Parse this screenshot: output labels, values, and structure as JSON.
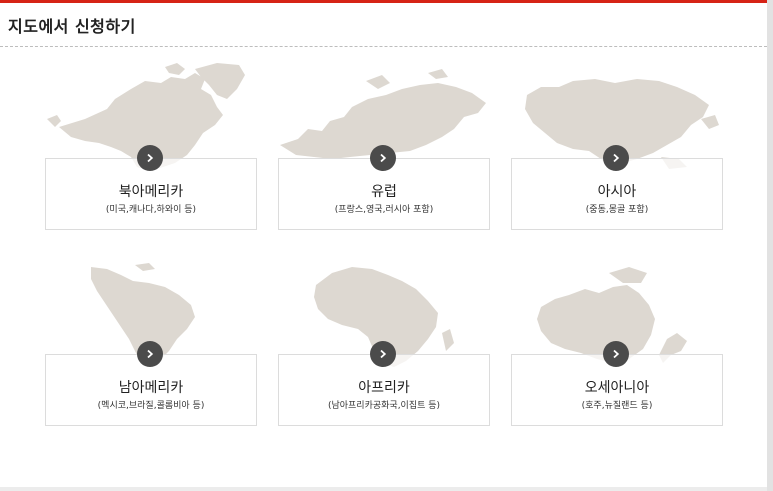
{
  "header": {
    "title": "지도에서 신청하기"
  },
  "colors": {
    "accent": "#d62316",
    "map": "#ddd8d1",
    "arrow_button": "#4b4b4b"
  },
  "regions": [
    {
      "name": "북아메리카",
      "sub": "(미국,캐나다,하와이 등)",
      "icon": "north-america-map"
    },
    {
      "name": "유럽",
      "sub": "(프랑스,영국,러시아 포함)",
      "icon": "europe-map"
    },
    {
      "name": "아시아",
      "sub": "(중동,몽골 포함)",
      "icon": "asia-map"
    },
    {
      "name": "남아메리카",
      "sub": "(멕시코,브라질,콜롬비아 등)",
      "icon": "south-america-map"
    },
    {
      "name": "아프리카",
      "sub": "(남아프리카공화국,이집트 등)",
      "icon": "africa-map"
    },
    {
      "name": "오세아니아",
      "sub": "(호주,뉴질랜드 등)",
      "icon": "oceania-map"
    }
  ]
}
